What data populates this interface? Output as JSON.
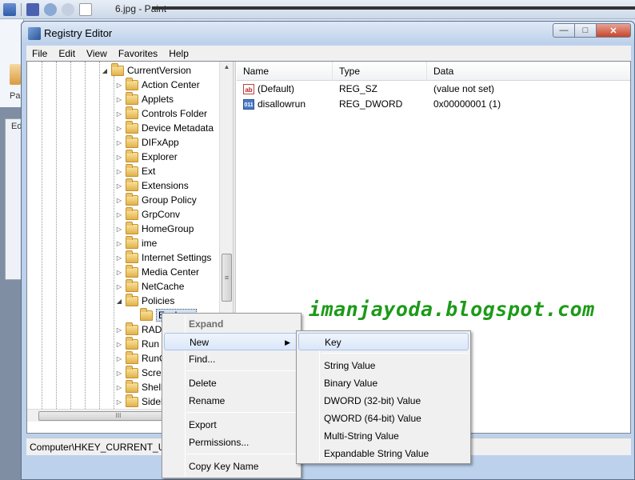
{
  "paint": {
    "title": "6.jpg - Paint",
    "ribbon_label": "Pa",
    "side_label": "Ed"
  },
  "regedit": {
    "title": "Registry Editor",
    "window_buttons": {
      "minimize": "—",
      "maximize": "□",
      "close": "✕"
    },
    "menu": [
      "File",
      "Edit",
      "View",
      "Favorites",
      "Help"
    ],
    "tree": [
      {
        "label": "CurrentVersion",
        "expanded": true,
        "indent": 0
      },
      {
        "label": "Action Center",
        "indent": 1
      },
      {
        "label": "Applets",
        "indent": 1
      },
      {
        "label": "Controls Folder",
        "indent": 1
      },
      {
        "label": "Device Metadata",
        "indent": 1
      },
      {
        "label": "DIFxApp",
        "indent": 1
      },
      {
        "label": "Explorer",
        "indent": 1
      },
      {
        "label": "Ext",
        "indent": 1
      },
      {
        "label": "Extensions",
        "indent": 1
      },
      {
        "label": "Group Policy",
        "indent": 1
      },
      {
        "label": "GrpConv",
        "indent": 1
      },
      {
        "label": "HomeGroup",
        "indent": 1
      },
      {
        "label": "ime",
        "indent": 1
      },
      {
        "label": "Internet Settings",
        "indent": 1
      },
      {
        "label": "Media Center",
        "indent": 1
      },
      {
        "label": "NetCache",
        "indent": 1
      },
      {
        "label": "Policies",
        "expanded": true,
        "indent": 1
      },
      {
        "label": "Explorer",
        "indent": 2,
        "selected": true
      },
      {
        "label": "RADAR",
        "indent": 1
      },
      {
        "label": "Run",
        "indent": 1
      },
      {
        "label": "RunOnce",
        "indent": 1
      },
      {
        "label": "Screensavers",
        "indent": 1
      },
      {
        "label": "Shell Extensions",
        "indent": 1
      },
      {
        "label": "Sidebar",
        "indent": 1
      }
    ],
    "columns": {
      "name": "Name",
      "type": "Type",
      "data": "Data"
    },
    "values": [
      {
        "name": "(Default)",
        "type": "REG_SZ",
        "data": "(value not set)",
        "icon": "string-value-icon"
      },
      {
        "name": "disallowrun",
        "type": "REG_DWORD",
        "data": "0x00000001 (1)",
        "icon": "dword-value-icon"
      }
    ],
    "status_path": "Computer\\HKEY_CURRENT_USER\\Software\\Microsoft\\Windows\\CurrentVersion\\Policies\\Explorer",
    "hscroll_glyph": "III",
    "tree_scroll_glyph": "≡"
  },
  "watermark": "imanjayoda.blogspot.com",
  "context_menu": {
    "items": [
      "Expand",
      "New",
      "Find...",
      "Delete",
      "Rename",
      "Export",
      "Permissions...",
      "Copy Key Name"
    ],
    "submenu_arrow": "▶"
  },
  "submenu": {
    "items": [
      "Key",
      "String Value",
      "Binary Value",
      "DWORD (32-bit) Value",
      "QWORD (64-bit) Value",
      "Multi-String Value",
      "Expandable String Value"
    ]
  },
  "colors": {
    "watermark": "#1d9a18",
    "highlight": "#dbe7f8",
    "titlebar": "#bcd0ea"
  }
}
